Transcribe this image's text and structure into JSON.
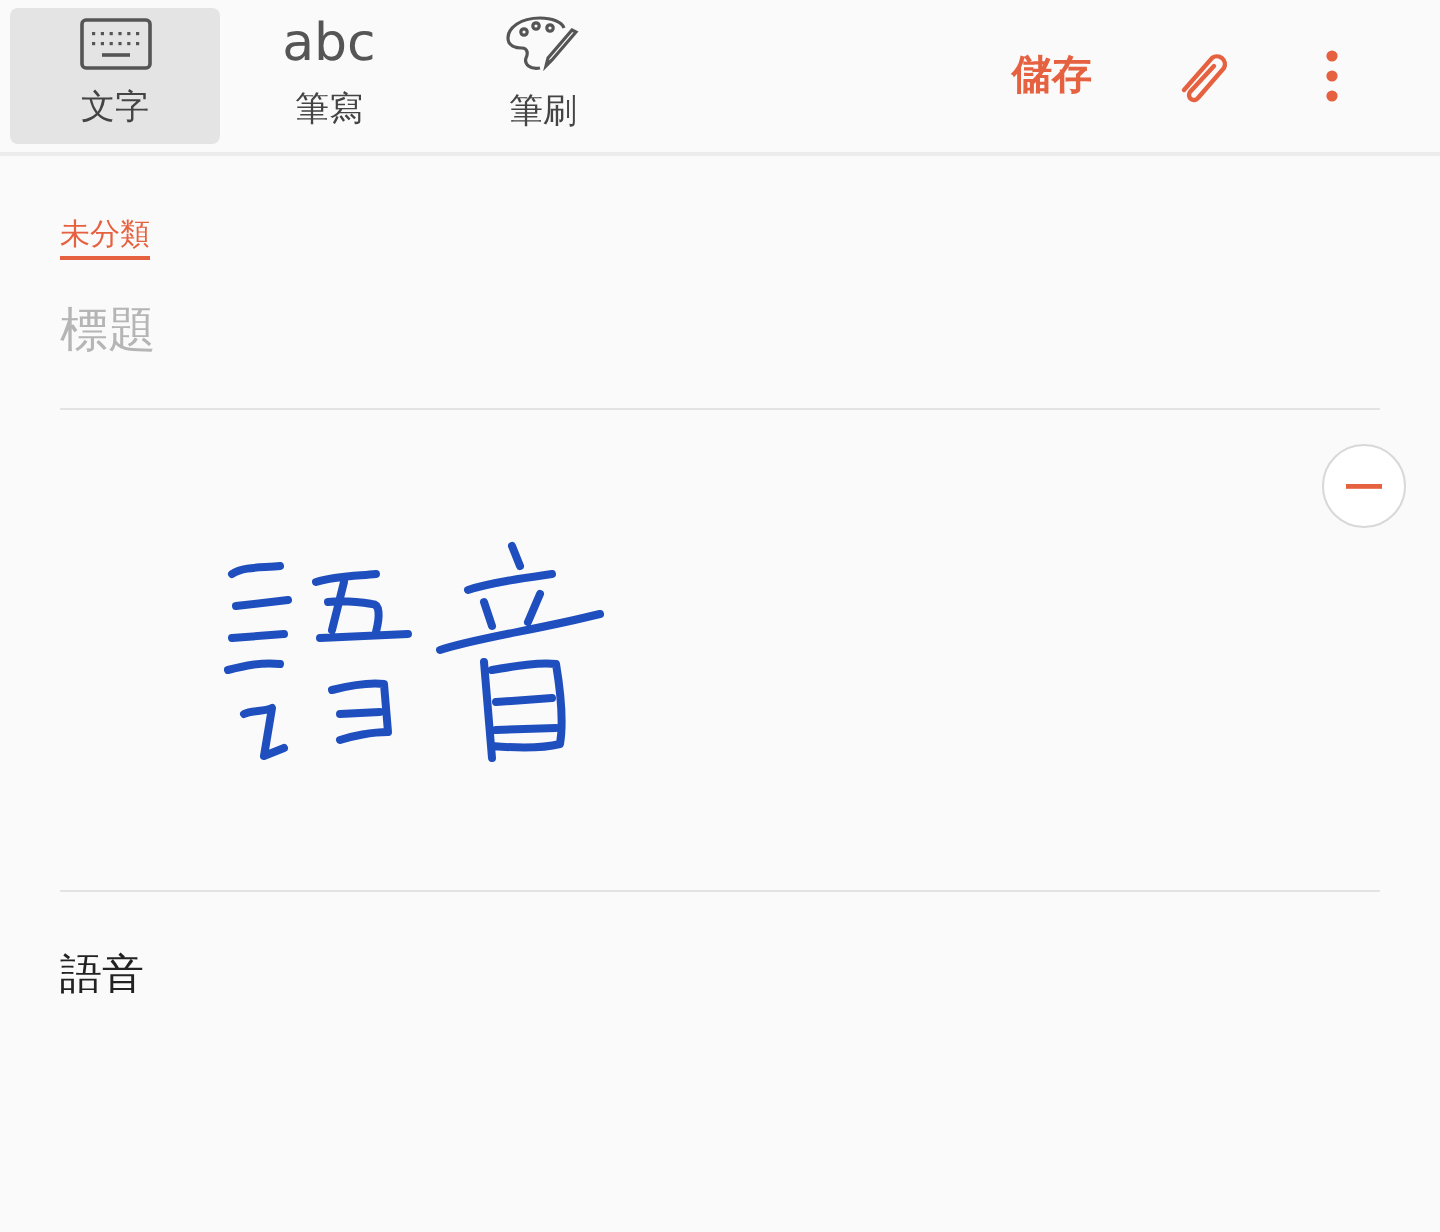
{
  "toolbar": {
    "modes": [
      {
        "kind": "keyboard",
        "label": "文字",
        "selected": true
      },
      {
        "kind": "abc",
        "icon_text": "abc",
        "label": "筆寫",
        "selected": false
      },
      {
        "kind": "palette",
        "label": "筆刷",
        "selected": false
      }
    ],
    "save": "儲存"
  },
  "note": {
    "category": "未分類",
    "title_placeholder": "標題",
    "recognized_text": "語音"
  }
}
